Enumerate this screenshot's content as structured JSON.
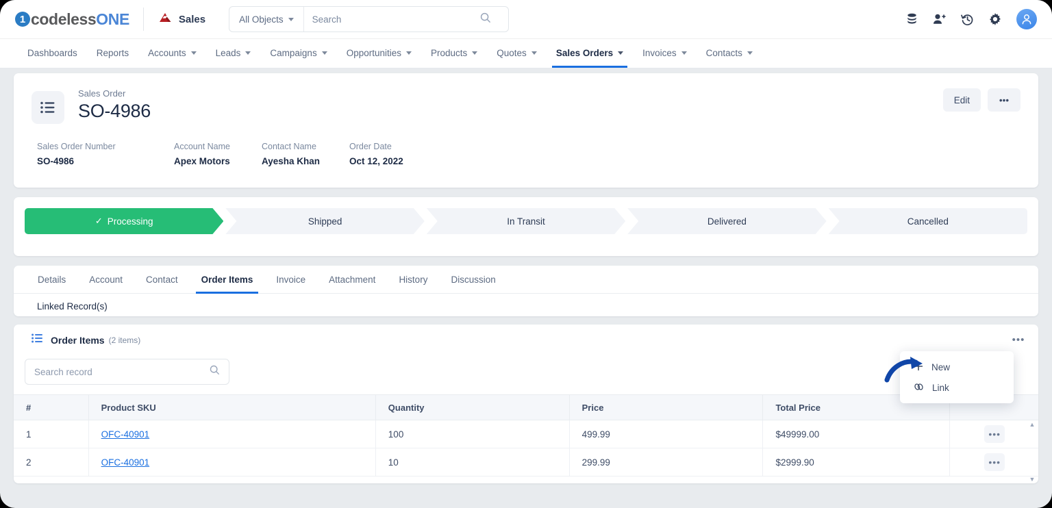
{
  "brand": {
    "logo_mark": "1",
    "logo_text_a": "codeless",
    "logo_text_b": "ONE",
    "app_icon": "sales-app-icon",
    "app_name": "Sales",
    "accent_blue": "#1a6fe0",
    "accent_green": "#26bd76"
  },
  "search": {
    "object_filter": "All Objects",
    "placeholder": "Search",
    "icon": "search-icon",
    "caret_icon": "chevron-down-icon"
  },
  "header_icons": [
    {
      "name": "database-icon",
      "label": "Data"
    },
    {
      "name": "add-user-icon",
      "label": "Add User"
    },
    {
      "name": "history-icon",
      "label": "Recent"
    },
    {
      "name": "gear-icon",
      "label": "Settings"
    },
    {
      "name": "avatar-icon",
      "label": "Profile"
    }
  ],
  "nav": {
    "items": [
      {
        "label": "Dashboards",
        "has_caret": false,
        "active": false
      },
      {
        "label": "Reports",
        "has_caret": false,
        "active": false
      },
      {
        "label": "Accounts",
        "has_caret": true,
        "active": false
      },
      {
        "label": "Leads",
        "has_caret": true,
        "active": false
      },
      {
        "label": "Campaigns",
        "has_caret": true,
        "active": false
      },
      {
        "label": "Opportunities",
        "has_caret": true,
        "active": false
      },
      {
        "label": "Products",
        "has_caret": true,
        "active": false
      },
      {
        "label": "Quotes",
        "has_caret": true,
        "active": false
      },
      {
        "label": "Sales Orders",
        "has_caret": true,
        "active": true
      },
      {
        "label": "Invoices",
        "has_caret": true,
        "active": false
      },
      {
        "label": "Contacts",
        "has_caret": true,
        "active": false
      }
    ]
  },
  "record": {
    "icon": "list-icon",
    "object_label": "Sales Order",
    "title": "SO-4986",
    "edit_label": "Edit",
    "more_label": "•••",
    "fields": [
      {
        "label": "Sales Order Number",
        "value": "SO-4986"
      },
      {
        "label": "Account Name",
        "value": "Apex Motors"
      },
      {
        "label": "Contact Name",
        "value": "Ayesha Khan"
      },
      {
        "label": "Order Date",
        "value": "Oct 12, 2022"
      }
    ]
  },
  "path": {
    "check_icon": "check-icon",
    "steps": [
      {
        "label": "Processing",
        "state": "done"
      },
      {
        "label": "Shipped",
        "state": "pending"
      },
      {
        "label": "In Transit",
        "state": "pending"
      },
      {
        "label": "Delivered",
        "state": "pending"
      },
      {
        "label": "Cancelled",
        "state": "pending"
      }
    ]
  },
  "tabs": {
    "items": [
      {
        "label": "Details",
        "active": false
      },
      {
        "label": "Account",
        "active": false
      },
      {
        "label": "Contact",
        "active": false
      },
      {
        "label": "Order Items",
        "active": true
      },
      {
        "label": "Invoice",
        "active": false
      },
      {
        "label": "Attachment",
        "active": false
      },
      {
        "label": "History",
        "active": false
      },
      {
        "label": "Discussion",
        "active": false
      }
    ],
    "linked_records_label": "Linked Record(s)"
  },
  "order_items": {
    "panel_icon": "list-icon",
    "panel_title": "Order Items",
    "panel_count": "(2 items)",
    "panel_menu_label": "•••",
    "search_placeholder": "Search record",
    "search_icon": "search-icon",
    "columns": [
      "#",
      "Product SKU",
      "Quantity",
      "Price",
      "Total Price",
      ""
    ],
    "rows": [
      {
        "n": "1",
        "sku": "OFC-40901",
        "quantity": "100",
        "price": "499.99",
        "total_price": "$49999.00",
        "menu": "•••"
      },
      {
        "n": "2",
        "sku": "OFC-40901",
        "quantity": "10",
        "price": "299.99",
        "total_price": "$2999.90",
        "menu": "•••"
      }
    ],
    "scroll_up_icon": "▲",
    "scroll_down_icon": "▼"
  },
  "dropdown": {
    "items": [
      {
        "label": "New",
        "icon": "plus-icon"
      },
      {
        "label": "Link",
        "icon": "link-icon"
      }
    ],
    "annotation": "blue-curved-arrow"
  }
}
